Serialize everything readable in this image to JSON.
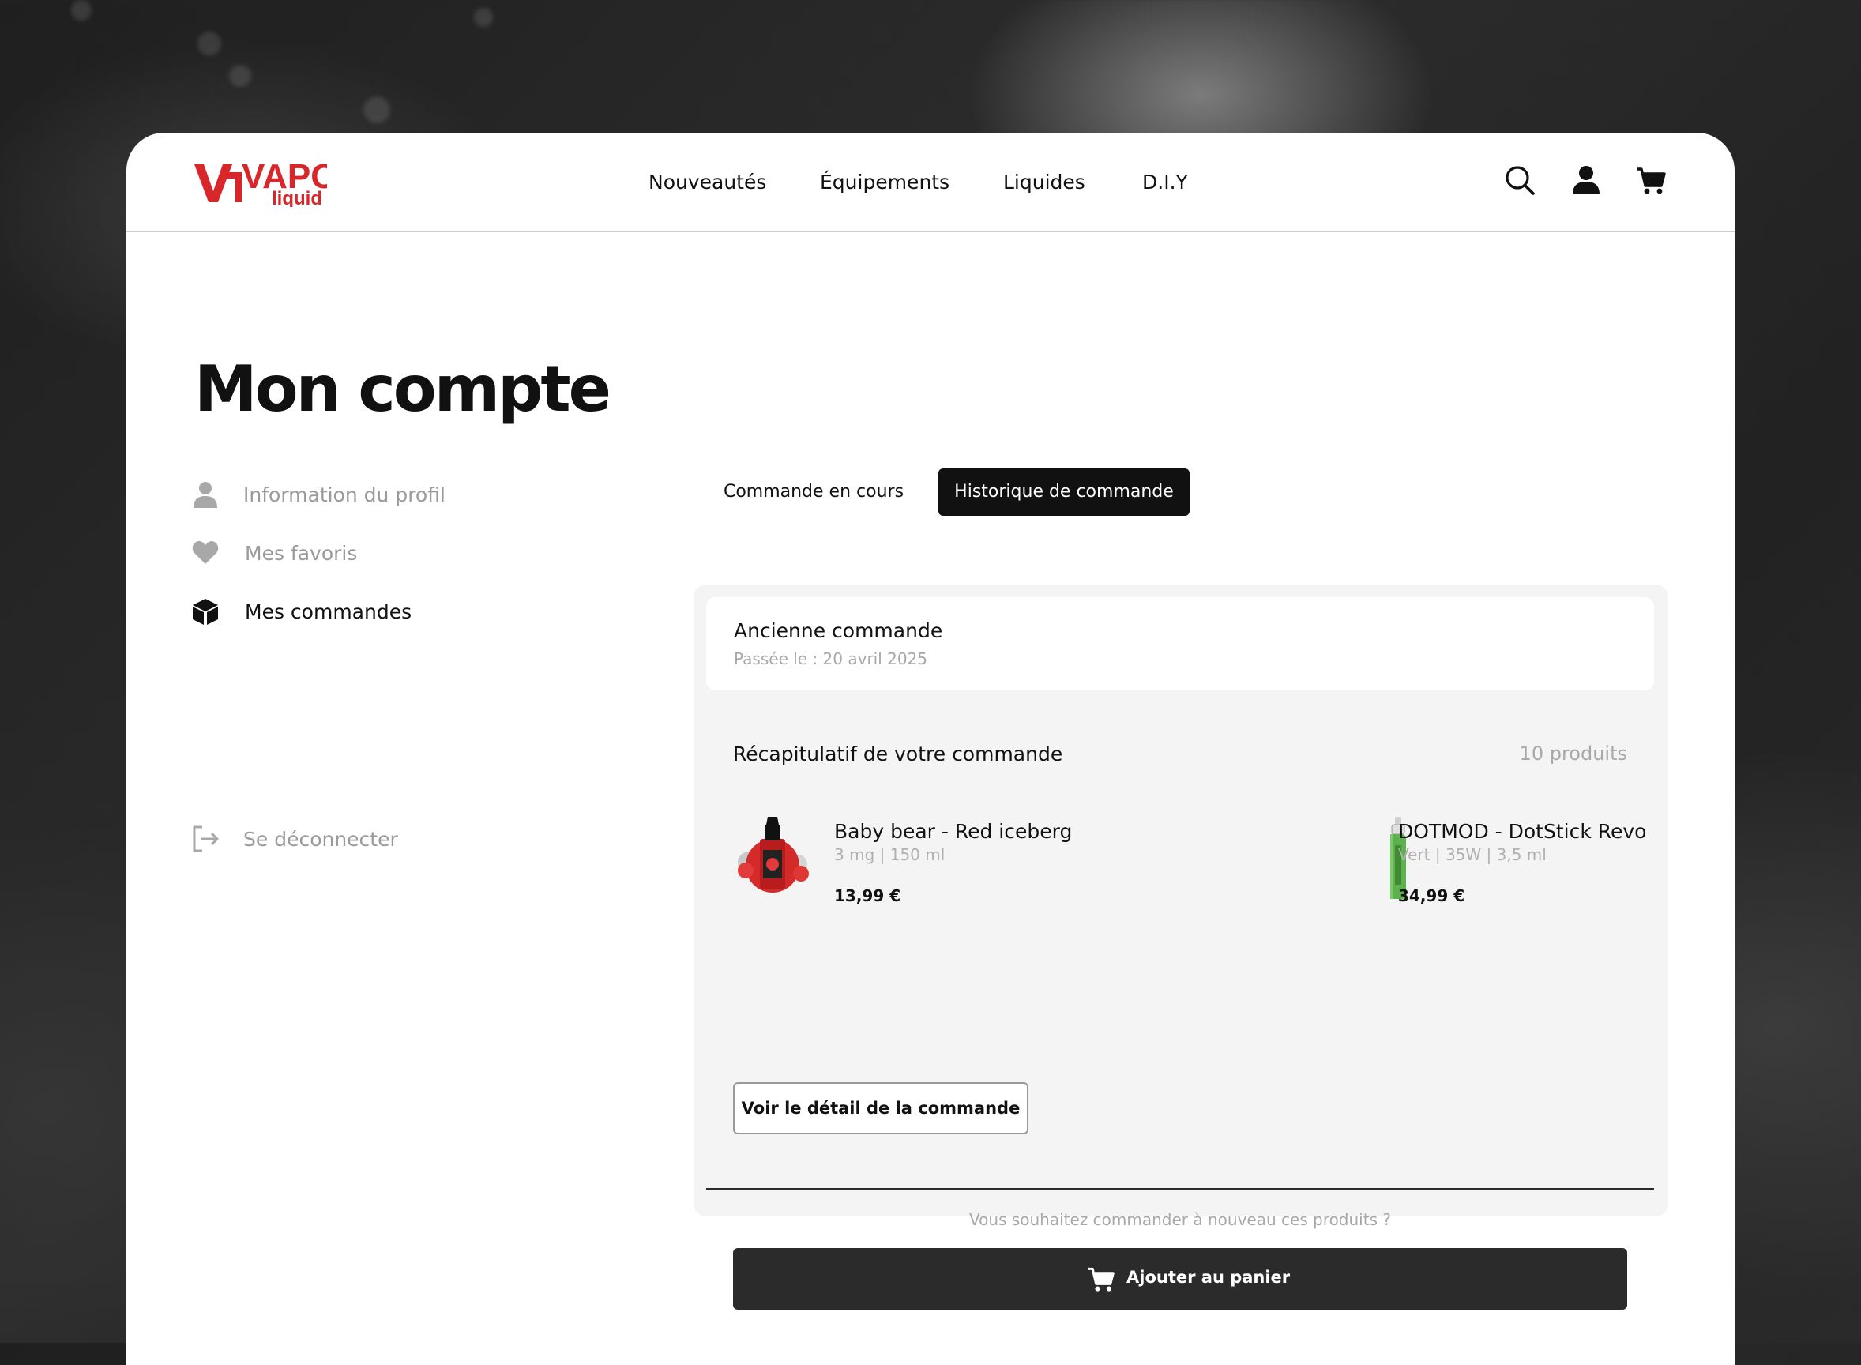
{
  "brand": {
    "logo_main": "VAPO",
    "logo_sub": "liquid",
    "accent": "#d8262b"
  },
  "nav": {
    "items": [
      "Nouveautés",
      "Équipements",
      "Liquides",
      "D.I.Y"
    ]
  },
  "header_icons": [
    "search-icon",
    "user-icon",
    "cart-icon"
  ],
  "page": {
    "title": "Mon compte"
  },
  "sidebar": {
    "items": [
      {
        "label": "Information du profil",
        "icon": "user-icon",
        "active": false
      },
      {
        "label": "Mes favoris",
        "icon": "heart-icon",
        "active": false
      },
      {
        "label": "Mes commandes",
        "icon": "box-icon",
        "active": true
      },
      {
        "label": "Se déconnecter",
        "icon": "logout-icon",
        "active": false
      }
    ]
  },
  "tabs": [
    {
      "label": "Commande en cours",
      "active": false
    },
    {
      "label": "Historique de commande",
      "active": true
    }
  ],
  "order": {
    "title": "Ancienne commande",
    "date": "Passée le : 20 avril 2025",
    "recap_title": "Récapitulatif de votre commande",
    "count": "10 produits",
    "products": [
      {
        "name": "Baby bear - Red iceberg",
        "meta": "3 mg | 150 ml",
        "price": "13,99 €"
      },
      {
        "name": "DOTMOD - DotStick Revo",
        "meta": "Vert | 35W | 3,5 ml",
        "price": "34,99 €"
      }
    ],
    "detail_button": "Voir le détail de la commande",
    "reorder_question": "Vous souhaitez commander à nouveau ces produits ?",
    "add_to_cart": "Ajouter au panier"
  }
}
